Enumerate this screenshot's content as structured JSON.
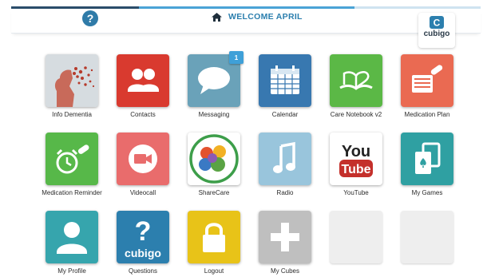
{
  "header": {
    "help_glyph": "?",
    "welcome_text": "WELCOME APRIL",
    "logo_glyph": "C",
    "logo_text": "cubigo"
  },
  "colors": {
    "accent": "#2c7fae",
    "help_button": "#2f7ba8",
    "badge": "#3fa0d8"
  },
  "tiles": [
    {
      "label": "Info Dementia",
      "icon": "brain-icon",
      "color": "#d9d9d9"
    },
    {
      "label": "Contacts",
      "icon": "people-icon",
      "color": "#d93a2f"
    },
    {
      "label": "Messaging",
      "icon": "speech-bubble-icon",
      "color": "#6aa2b9",
      "badge": "1"
    },
    {
      "label": "Calendar",
      "icon": "calendar-icon",
      "color": "#3878b0"
    },
    {
      "label": "Care Notebook v2",
      "icon": "book-heart-icon",
      "color": "#5bb846"
    },
    {
      "label": "Medication Plan",
      "icon": "pill-list-icon",
      "color": "#ea6a52"
    },
    {
      "label": "Medication Reminder",
      "icon": "alarm-clock-icon",
      "color": "#57b849"
    },
    {
      "label": "Videocall",
      "icon": "video-camera-icon",
      "color": "#e96c6c"
    },
    {
      "label": "ShareCare",
      "icon": "sharecare-logo-icon",
      "color": "#ffffff"
    },
    {
      "label": "Radio",
      "icon": "music-note-icon",
      "color": "#99c5dc"
    },
    {
      "label": "YouTube",
      "icon": "youtube-logo-icon",
      "color": "#ffffff"
    },
    {
      "label": "My Games",
      "icon": "playing-cards-icon",
      "color": "#2fa0a2"
    },
    {
      "label": "My Profile",
      "icon": "person-icon",
      "color": "#36a5ad"
    },
    {
      "label": "Questions",
      "icon": "question-cubigo-icon",
      "color": "#2c7fae",
      "glyph": "?",
      "sub": "cubigo"
    },
    {
      "label": "Logout",
      "icon": "padlock-icon",
      "color": "#e8c318"
    },
    {
      "label": "My Cubes",
      "icon": "plus-icon",
      "color": "#bfbfbf"
    },
    {
      "label": "",
      "icon": "",
      "color": "#eeeeee"
    },
    {
      "label": "",
      "icon": "",
      "color": "#eeeeee"
    }
  ]
}
